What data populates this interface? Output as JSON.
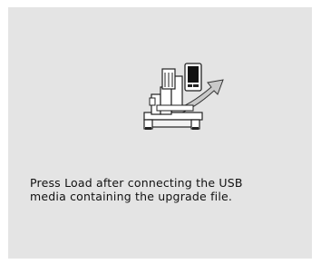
{
  "screen": {
    "message_lines": [
      "Press Load after connecting the USB",
      "media containing the upgrade file."
    ]
  },
  "illustration": {
    "icon": "embroidery-machine-upgrade-icon",
    "arrow_color": "#c8c8c8",
    "outline_color": "#222222",
    "screen_color": "#111111"
  }
}
